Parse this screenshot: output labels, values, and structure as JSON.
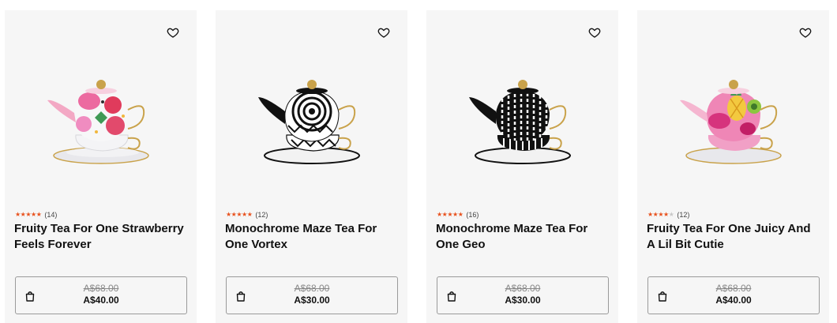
{
  "icons": {
    "wishlist": "heart-outline-icon",
    "cart": "shopping-bag-icon",
    "rating": "star-icon"
  },
  "colors": {
    "card_bg": "#f6f6f6",
    "star": "#e8521e",
    "strike_price": "#888888"
  },
  "products": [
    {
      "title": "Fruity Tea For One Strawberry Feels Forever",
      "rating": 4.5,
      "review_count": "(14)",
      "old_price": "A$68.00",
      "price": "A$40.00",
      "image_style": "fruity-pink"
    },
    {
      "title": "Monochrome Maze Tea For One Vortex",
      "rating": 5,
      "review_count": "(12)",
      "old_price": "A$68.00",
      "price": "A$30.00",
      "image_style": "monochrome-vortex"
    },
    {
      "title": "Monochrome Maze Tea For One Geo",
      "rating": 5,
      "review_count": "(16)",
      "old_price": "A$68.00",
      "price": "A$30.00",
      "image_style": "monochrome-geo"
    },
    {
      "title": "Fruity Tea For One Juicy And A Lil Bit Cutie",
      "rating": 4,
      "review_count": "(12)",
      "old_price": "A$68.00",
      "price": "A$40.00",
      "image_style": "fruity-pink-pineapple"
    }
  ]
}
